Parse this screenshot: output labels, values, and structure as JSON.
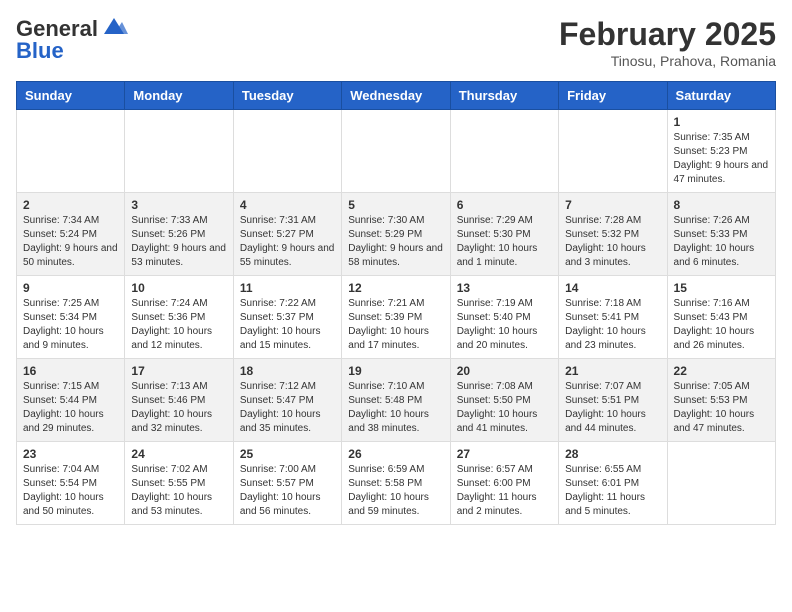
{
  "header": {
    "logo_general": "General",
    "logo_blue": "Blue",
    "month_year": "February 2025",
    "location": "Tinosu, Prahova, Romania"
  },
  "weekdays": [
    "Sunday",
    "Monday",
    "Tuesday",
    "Wednesday",
    "Thursday",
    "Friday",
    "Saturday"
  ],
  "weeks": [
    [
      {
        "day": "",
        "info": ""
      },
      {
        "day": "",
        "info": ""
      },
      {
        "day": "",
        "info": ""
      },
      {
        "day": "",
        "info": ""
      },
      {
        "day": "",
        "info": ""
      },
      {
        "day": "",
        "info": ""
      },
      {
        "day": "1",
        "info": "Sunrise: 7:35 AM\nSunset: 5:23 PM\nDaylight: 9 hours and 47 minutes."
      }
    ],
    [
      {
        "day": "2",
        "info": "Sunrise: 7:34 AM\nSunset: 5:24 PM\nDaylight: 9 hours and 50 minutes."
      },
      {
        "day": "3",
        "info": "Sunrise: 7:33 AM\nSunset: 5:26 PM\nDaylight: 9 hours and 53 minutes."
      },
      {
        "day": "4",
        "info": "Sunrise: 7:31 AM\nSunset: 5:27 PM\nDaylight: 9 hours and 55 minutes."
      },
      {
        "day": "5",
        "info": "Sunrise: 7:30 AM\nSunset: 5:29 PM\nDaylight: 9 hours and 58 minutes."
      },
      {
        "day": "6",
        "info": "Sunrise: 7:29 AM\nSunset: 5:30 PM\nDaylight: 10 hours and 1 minute."
      },
      {
        "day": "7",
        "info": "Sunrise: 7:28 AM\nSunset: 5:32 PM\nDaylight: 10 hours and 3 minutes."
      },
      {
        "day": "8",
        "info": "Sunrise: 7:26 AM\nSunset: 5:33 PM\nDaylight: 10 hours and 6 minutes."
      }
    ],
    [
      {
        "day": "9",
        "info": "Sunrise: 7:25 AM\nSunset: 5:34 PM\nDaylight: 10 hours and 9 minutes."
      },
      {
        "day": "10",
        "info": "Sunrise: 7:24 AM\nSunset: 5:36 PM\nDaylight: 10 hours and 12 minutes."
      },
      {
        "day": "11",
        "info": "Sunrise: 7:22 AM\nSunset: 5:37 PM\nDaylight: 10 hours and 15 minutes."
      },
      {
        "day": "12",
        "info": "Sunrise: 7:21 AM\nSunset: 5:39 PM\nDaylight: 10 hours and 17 minutes."
      },
      {
        "day": "13",
        "info": "Sunrise: 7:19 AM\nSunset: 5:40 PM\nDaylight: 10 hours and 20 minutes."
      },
      {
        "day": "14",
        "info": "Sunrise: 7:18 AM\nSunset: 5:41 PM\nDaylight: 10 hours and 23 minutes."
      },
      {
        "day": "15",
        "info": "Sunrise: 7:16 AM\nSunset: 5:43 PM\nDaylight: 10 hours and 26 minutes."
      }
    ],
    [
      {
        "day": "16",
        "info": "Sunrise: 7:15 AM\nSunset: 5:44 PM\nDaylight: 10 hours and 29 minutes."
      },
      {
        "day": "17",
        "info": "Sunrise: 7:13 AM\nSunset: 5:46 PM\nDaylight: 10 hours and 32 minutes."
      },
      {
        "day": "18",
        "info": "Sunrise: 7:12 AM\nSunset: 5:47 PM\nDaylight: 10 hours and 35 minutes."
      },
      {
        "day": "19",
        "info": "Sunrise: 7:10 AM\nSunset: 5:48 PM\nDaylight: 10 hours and 38 minutes."
      },
      {
        "day": "20",
        "info": "Sunrise: 7:08 AM\nSunset: 5:50 PM\nDaylight: 10 hours and 41 minutes."
      },
      {
        "day": "21",
        "info": "Sunrise: 7:07 AM\nSunset: 5:51 PM\nDaylight: 10 hours and 44 minutes."
      },
      {
        "day": "22",
        "info": "Sunrise: 7:05 AM\nSunset: 5:53 PM\nDaylight: 10 hours and 47 minutes."
      }
    ],
    [
      {
        "day": "23",
        "info": "Sunrise: 7:04 AM\nSunset: 5:54 PM\nDaylight: 10 hours and 50 minutes."
      },
      {
        "day": "24",
        "info": "Sunrise: 7:02 AM\nSunset: 5:55 PM\nDaylight: 10 hours and 53 minutes."
      },
      {
        "day": "25",
        "info": "Sunrise: 7:00 AM\nSunset: 5:57 PM\nDaylight: 10 hours and 56 minutes."
      },
      {
        "day": "26",
        "info": "Sunrise: 6:59 AM\nSunset: 5:58 PM\nDaylight: 10 hours and 59 minutes."
      },
      {
        "day": "27",
        "info": "Sunrise: 6:57 AM\nSunset: 6:00 PM\nDaylight: 11 hours and 2 minutes."
      },
      {
        "day": "28",
        "info": "Sunrise: 6:55 AM\nSunset: 6:01 PM\nDaylight: 11 hours and 5 minutes."
      },
      {
        "day": "",
        "info": ""
      }
    ]
  ]
}
